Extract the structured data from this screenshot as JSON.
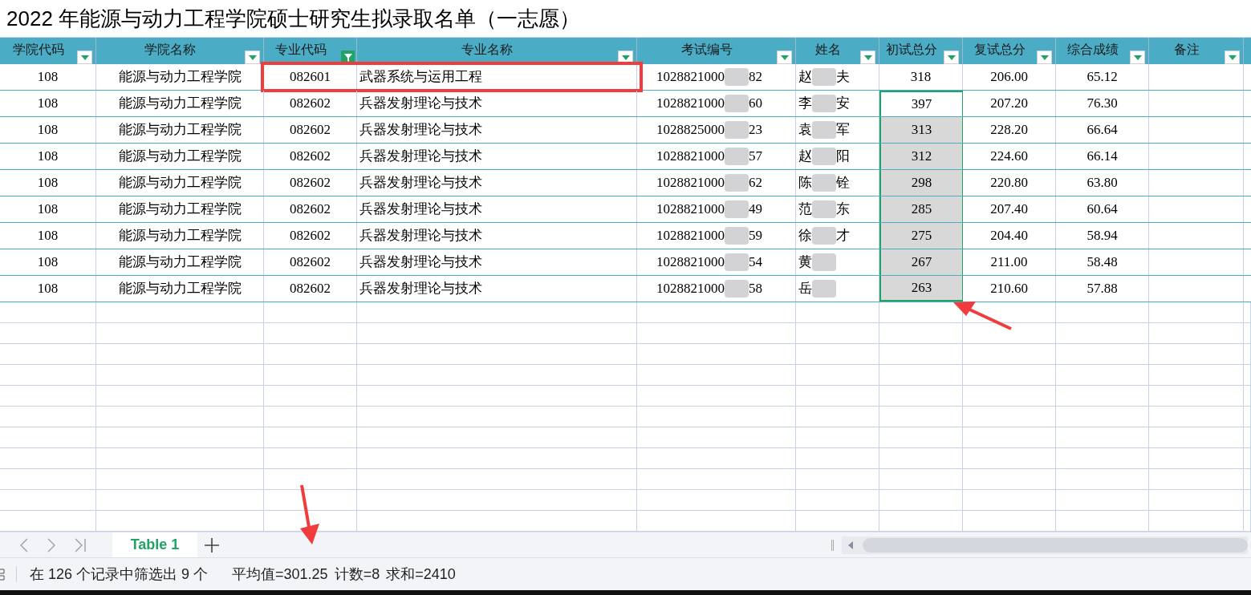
{
  "title": "2022 年能源与动力工程学院硕士研究生拟录取名单（一志愿）",
  "columns": [
    {
      "label": "学院代码",
      "filtered": false
    },
    {
      "label": "学院名称",
      "filtered": false
    },
    {
      "label": "专业代码",
      "filtered": true
    },
    {
      "label": "专业名称",
      "filtered": false
    },
    {
      "label": "考试编号",
      "filtered": false
    },
    {
      "label": "姓名",
      "filtered": false
    },
    {
      "label": "初试总分",
      "filtered": false
    },
    {
      "label": "复试总分",
      "filtered": false
    },
    {
      "label": "综合成绩",
      "filtered": false
    },
    {
      "label": "备注",
      "filtered": false
    }
  ],
  "rows": [
    {
      "school_code": "108",
      "school": "能源与动力工程学院",
      "major_code": "082601",
      "major": "武器系统与运用工程",
      "exam_id_start": "1028821000",
      "exam_id_end": "82",
      "name_first": "赵",
      "name_last": "夫",
      "prelim": "318",
      "retest": "206.00",
      "total": "65.12",
      "selected": false,
      "active": false,
      "boxed": true
    },
    {
      "school_code": "108",
      "school": "能源与动力工程学院",
      "major_code": "082602",
      "major": "兵器发射理论与技术",
      "exam_id_start": "1028821000",
      "exam_id_end": "60",
      "name_first": "李",
      "name_last": "安",
      "prelim": "397",
      "retest": "207.20",
      "total": "76.30",
      "selected": true,
      "active": true,
      "boxed": false
    },
    {
      "school_code": "108",
      "school": "能源与动力工程学院",
      "major_code": "082602",
      "major": "兵器发射理论与技术",
      "exam_id_start": "1028825000",
      "exam_id_end": "23",
      "name_first": "袁",
      "name_last": "军",
      "prelim": "313",
      "retest": "228.20",
      "total": "66.64",
      "selected": true,
      "active": false,
      "boxed": false
    },
    {
      "school_code": "108",
      "school": "能源与动力工程学院",
      "major_code": "082602",
      "major": "兵器发射理论与技术",
      "exam_id_start": "1028821000",
      "exam_id_end": "57",
      "name_first": "赵",
      "name_last": "阳",
      "prelim": "312",
      "retest": "224.60",
      "total": "66.14",
      "selected": true,
      "active": false,
      "boxed": false
    },
    {
      "school_code": "108",
      "school": "能源与动力工程学院",
      "major_code": "082602",
      "major": "兵器发射理论与技术",
      "exam_id_start": "1028821000",
      "exam_id_end": "62",
      "name_first": "陈",
      "name_last": "铨",
      "prelim": "298",
      "retest": "220.80",
      "total": "63.80",
      "selected": true,
      "active": false,
      "boxed": false
    },
    {
      "school_code": "108",
      "school": "能源与动力工程学院",
      "major_code": "082602",
      "major": "兵器发射理论与技术",
      "exam_id_start": "1028821000",
      "exam_id_end": "49",
      "name_first": "范",
      "name_last": "东",
      "prelim": "285",
      "retest": "207.40",
      "total": "60.64",
      "selected": true,
      "active": false,
      "boxed": false
    },
    {
      "school_code": "108",
      "school": "能源与动力工程学院",
      "major_code": "082602",
      "major": "兵器发射理论与技术",
      "exam_id_start": "1028821000",
      "exam_id_end": "59",
      "name_first": "徐",
      "name_last": "才",
      "prelim": "275",
      "retest": "204.40",
      "total": "58.94",
      "selected": true,
      "active": false,
      "boxed": false
    },
    {
      "school_code": "108",
      "school": "能源与动力工程学院",
      "major_code": "082602",
      "major": "兵器发射理论与技术",
      "exam_id_start": "1028821000",
      "exam_id_end": "54",
      "name_first": "黄",
      "name_last": "",
      "prelim": "267",
      "retest": "211.00",
      "total": "58.48",
      "selected": true,
      "active": false,
      "boxed": false
    },
    {
      "school_code": "108",
      "school": "能源与动力工程学院",
      "major_code": "082602",
      "major": "兵器发射理论与技术",
      "exam_id_start": "1028821000",
      "exam_id_end": "58",
      "name_first": "岳",
      "name_last": "",
      "prelim": "263",
      "retest": "210.60",
      "total": "57.88",
      "selected": true,
      "active": false,
      "boxed": false
    }
  ],
  "sheet_tabs": [
    {
      "label": "Table 1",
      "selected": true
    }
  ],
  "status_bar": {
    "filter_info": "在 126 个记录中筛选出 9 个",
    "average": "平均值=301.25",
    "count": "计数=8",
    "sum": "求和=2410"
  }
}
